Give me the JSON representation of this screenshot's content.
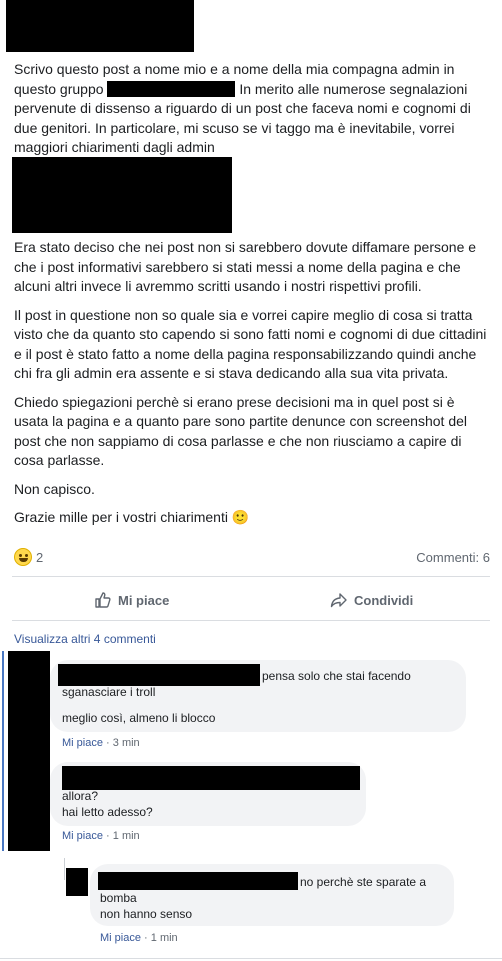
{
  "post": {
    "intro_line1": "Scrivo questo post a nome mio e a nome della mia compagna admin in",
    "intro_line2_a": "questo gruppo",
    "intro_line2_b": "In merito alle numerose segnalazioni",
    "intro_rest": "pervenute di dissenso a riguardo di un post che faceva nomi e cognomi di due genitori. In particolare, mi scuso se vi taggo ma è inevitabile, vorrei maggiori chiarimenti dagli admin",
    "paragraph2": "Era stato deciso che nei post non si sarebbero dovute diffamare persone e che i post informativi sarebbero si stati messi a nome della pagina e che alcuni altri invece li avremmo scritti usando i nostri rispettivi profili.",
    "paragraph3": "Il post in questione non so quale sia e vorrei capire meglio di cosa si tratta visto che da quanto sto capendo si sono fatti nomi e cognomi di due cittadini e il post è stato fatto a nome della pagina responsabilizzando quindi anche chi fra gli admin era assente e si stava dedicando alla sua vita privata.",
    "paragraph4": "Chiedo spiegazioni perchè si erano prese decisioni ma in quel post si è usata la pagina e a quanto pare sono partite denunce con screenshot del post che non sappiamo di cosa parlasse e che non riusciamo a capire di cosa parlasse.",
    "paragraph5": "Non capisco.",
    "paragraph6": "Grazie mille per i vostri chiarimenti 🙂"
  },
  "reactions": {
    "emoji": "haha-emoji",
    "count": "2",
    "comments_label": "Commenti: 6"
  },
  "actions": {
    "like_label": "Mi piace",
    "share_label": "Condividi"
  },
  "comments_section": {
    "view_more": "Visualizza altri 4 commenti",
    "comments": [
      {
        "line1": "pensa solo che stai facendo",
        "line2": "sganasciare i troll",
        "line3": "meglio così, almeno li blocco",
        "like": "Mi piace",
        "sep": "·",
        "time": "3 min"
      },
      {
        "line1": "allora?",
        "line2": "hai letto adesso?",
        "like": "Mi piace",
        "sep": "·",
        "time": "1 min"
      },
      {
        "line1": "no perchè ste sparate a",
        "line2": "bomba",
        "line3": "non hanno senso",
        "like": "Mi piace",
        "sep": "·",
        "time": "1 min"
      }
    ]
  },
  "colors": {
    "link": "#385898",
    "muted": "#606770",
    "bubble": "#f2f3f5",
    "thread_line": "#4a78c2"
  }
}
